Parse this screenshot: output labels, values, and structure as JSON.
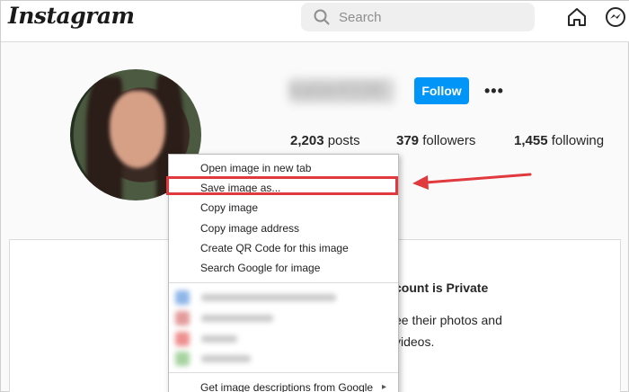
{
  "brand": {
    "logo_text": "Instagram"
  },
  "search": {
    "placeholder": "Search"
  },
  "profile": {
    "username": "katie4336",
    "follow_label": "Follow",
    "more_label": "•••",
    "stats": [
      {
        "count": "2,203",
        "label": "posts"
      },
      {
        "count": "379",
        "label": "followers"
      },
      {
        "count": "1,455",
        "label": "following"
      }
    ]
  },
  "private_notice": {
    "title": "count is Private",
    "line1": "ee their photos and",
    "line2": "videos."
  },
  "context_menu": {
    "items": [
      "Open image in new tab",
      "Save image as...",
      "Copy image",
      "Copy image address",
      "Create QR Code for this image",
      "Search Google for image"
    ],
    "bottom_item": "Get image descriptions from Google",
    "bottom_chevron": "▸",
    "highlighted_item": "Save image as...",
    "blurred_extensions_colors": [
      "#8fb6e8",
      "#e39a9a",
      "#ef8f8f",
      "#a7d3a0"
    ]
  },
  "annotation": {
    "color": "#e0393e"
  },
  "colors": {
    "accent": "#0095f6"
  }
}
